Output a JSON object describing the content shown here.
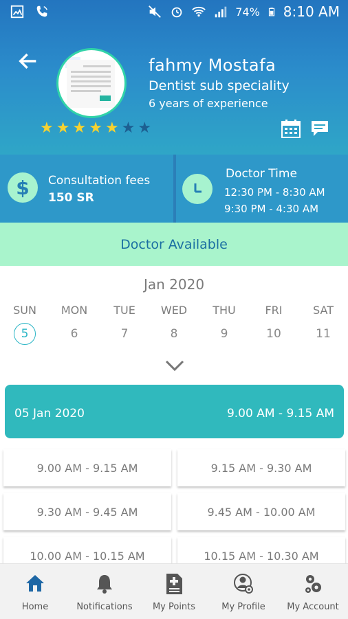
{
  "status_bar": {
    "battery": "74%",
    "time": "8:10 AM"
  },
  "doctor": {
    "name": "fahmy Mostafa",
    "specialty": "Dentist sub speciality",
    "experience": "6 years of experience",
    "rating": 5,
    "rating_max": 7
  },
  "consultation": {
    "label": "Consultation fees",
    "value": "150 SR"
  },
  "doctor_time": {
    "label": "Doctor Time",
    "slot_1": "12:30 PM - 8:30 AM",
    "slot_2": "9:30 PM - 4:30 AM"
  },
  "availability": "Doctor Available",
  "calendar": {
    "month": "Jan 2020",
    "weekdays": [
      "SUN",
      "MON",
      "TUE",
      "WED",
      "THU",
      "FRI",
      "SAT"
    ],
    "dates": [
      "5",
      "6",
      "7",
      "8",
      "9",
      "10",
      "11"
    ],
    "selected_index": 0
  },
  "selected_slot": {
    "date": "05 Jan 2020",
    "time": "9.00 AM - 9.15 AM"
  },
  "slots": [
    "9.00 AM - 9.15 AM",
    "9.15 AM - 9.30 AM",
    "9.30 AM - 9.45 AM",
    "9.45 AM - 10.00 AM",
    "10.00 AM - 10.15 AM",
    "10.15 AM - 10.30 AM"
  ],
  "bottom_nav": [
    {
      "label": "Home",
      "icon": "home-icon"
    },
    {
      "label": "Notifications",
      "icon": "bell-icon"
    },
    {
      "label": "My Points",
      "icon": "document-plus-icon"
    },
    {
      "label": "My Profile",
      "icon": "profile-gear-icon"
    },
    {
      "label": "My Account",
      "icon": "gears-icon"
    }
  ],
  "colors": {
    "header_top": "#2375bf",
    "accent_green": "#a9f4cc",
    "teal": "#30b9bd",
    "star": "#f6d230"
  }
}
